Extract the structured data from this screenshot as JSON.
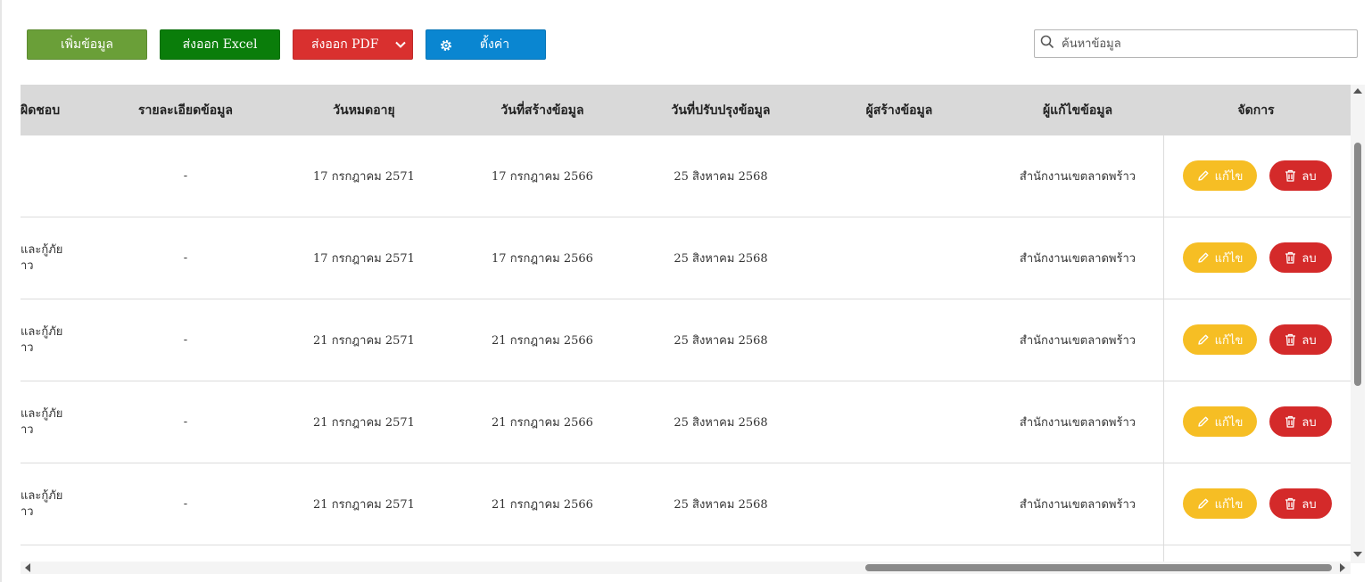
{
  "toolbar": {
    "add_label": "เพิ่มข้อมูล",
    "excel_label": "ส่งออก Excel",
    "pdf_label": "ส่งออก PDF",
    "settings_label": "ตั้งค่า"
  },
  "search": {
    "placeholder": "ค้นหาข้อมูล"
  },
  "table": {
    "headers": [
      "ผิดชอบ",
      "รายละเอียดข้อมูล",
      "วันหมดอายุ",
      "วันที่สร้างข้อมูล",
      "วันที่ปรับปรุงข้อมูล",
      "ผู้สร้างข้อมูล",
      "ผู้แก้ไขข้อมูล",
      "จัดการ"
    ],
    "rows": [
      {
        "first_line1": "",
        "first_line2": "",
        "detail": "-",
        "expire": "17 กรกฎาคม 2571",
        "created": "17 กรกฎาคม 2566",
        "updated": "25 สิงหาคม 2568",
        "creator": "",
        "editor": "สำนักงานเขตลาดพร้าว"
      },
      {
        "first_line1": "และกู้ภัย",
        "first_line2": "าว",
        "detail": "-",
        "expire": "17 กรกฎาคม 2571",
        "created": "17 กรกฎาคม 2566",
        "updated": "25 สิงหาคม 2568",
        "creator": "",
        "editor": "สำนักงานเขตลาดพร้าว"
      },
      {
        "first_line1": "และกู้ภัย",
        "first_line2": "าว",
        "detail": "-",
        "expire": "21 กรกฎาคม 2571",
        "created": "21 กรกฎาคม 2566",
        "updated": "25 สิงหาคม 2568",
        "creator": "",
        "editor": "สำนักงานเขตลาดพร้าว"
      },
      {
        "first_line1": "และกู้ภัย",
        "first_line2": "าว",
        "detail": "-",
        "expire": "21 กรกฎาคม 2571",
        "created": "21 กรกฎาคม 2566",
        "updated": "25 สิงหาคม 2568",
        "creator": "",
        "editor": "สำนักงานเขตลาดพร้าว"
      },
      {
        "first_line1": "และกู้ภัย",
        "first_line2": "าว",
        "detail": "-",
        "expire": "21 กรกฎาคม 2571",
        "created": "21 กรกฎาคม 2566",
        "updated": "25 สิงหาคม 2568",
        "creator": "",
        "editor": "สำนักงานเขตลาดพร้าว"
      }
    ],
    "actions": {
      "edit_label": "แก้ไข",
      "delete_label": "ลบ"
    }
  },
  "colors": {
    "add": "#6a9f38",
    "excel": "#0a7d0a",
    "pdf": "#d9302f",
    "settings": "#0a86d1",
    "edit": "#f6be24",
    "delete": "#d42a2a",
    "header_bg": "#d9d9d9"
  },
  "icons": [
    "chevron-down-icon",
    "gear-icon",
    "search-icon",
    "pencil-icon",
    "trash-icon"
  ]
}
